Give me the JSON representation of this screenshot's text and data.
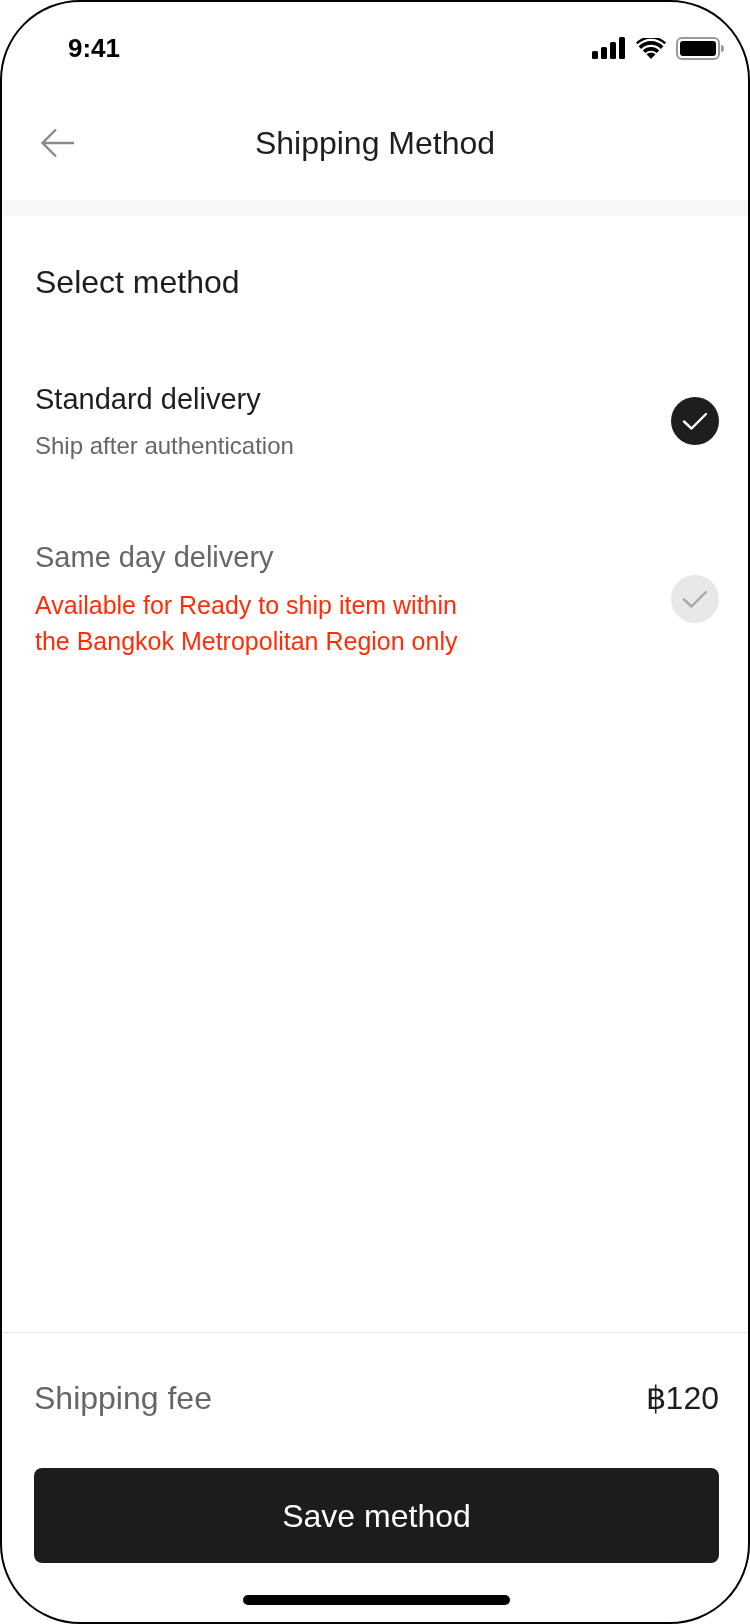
{
  "status_bar": {
    "time": "9:41"
  },
  "header": {
    "title": "Shipping Method"
  },
  "section": {
    "title": "Select method"
  },
  "methods": [
    {
      "name": "Standard delivery",
      "note": "Ship after authentication",
      "kind": "info",
      "selected": true,
      "disabled": false
    },
    {
      "name": "Same day delivery",
      "note": "Available for Ready to ship item within the Bangkok Metropolitan Region only",
      "kind": "warning",
      "selected": false,
      "disabled": true
    }
  ],
  "footer": {
    "fee_label": "Shipping fee",
    "fee_value": "฿120",
    "button": "Save method"
  }
}
